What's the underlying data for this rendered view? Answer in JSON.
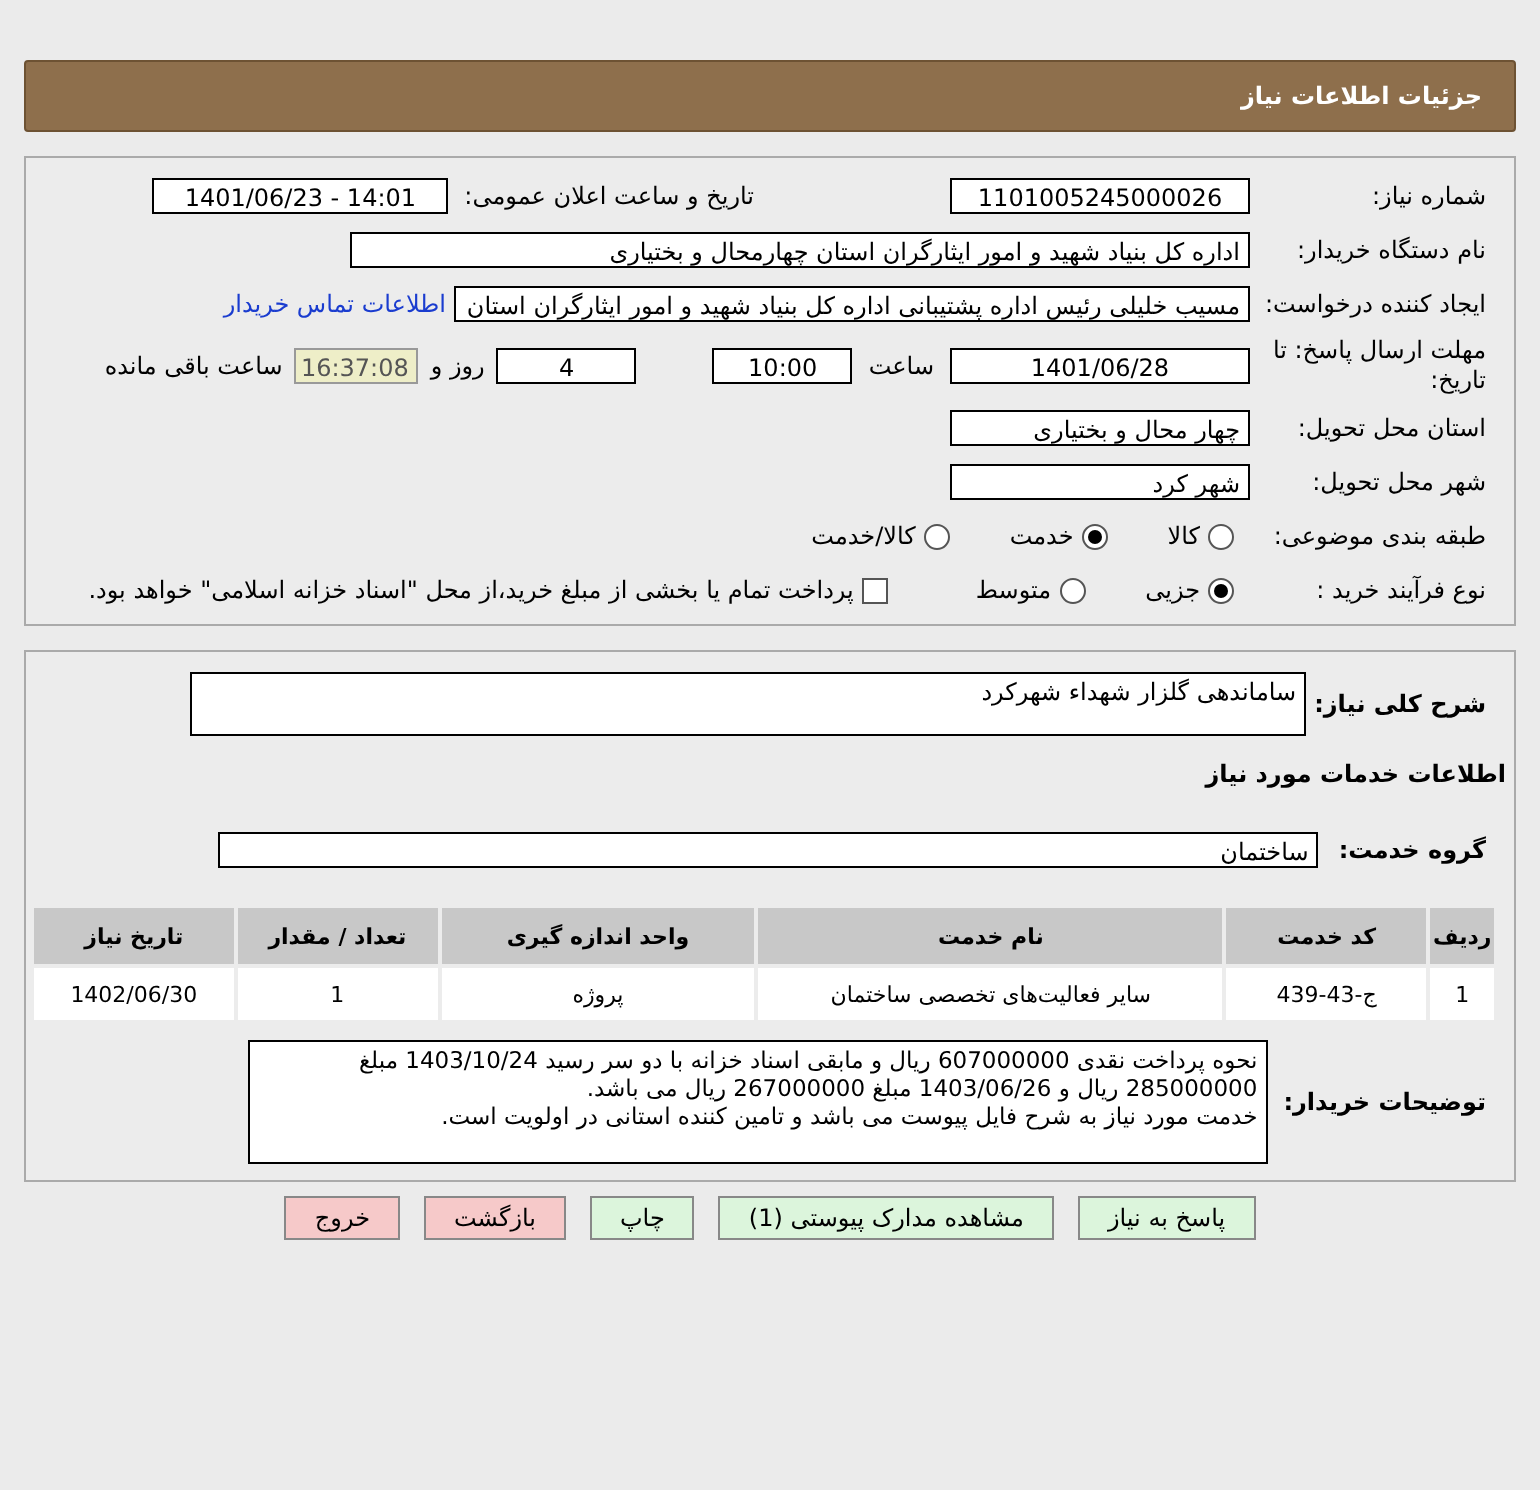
{
  "header": {
    "title": "جزئیات اطلاعات نیاز"
  },
  "need_number": {
    "label": "شماره نیاز:",
    "value": "1101005245000026"
  },
  "announce": {
    "label": "تاریخ و ساعت اعلان عمومی:",
    "value": "1401/06/23 - 14:01"
  },
  "buyer": {
    "label": "نام دستگاه خریدار:",
    "value": "اداره کل بنیاد شهید و امور ایثارگران استان چهارمحال و بختیاری"
  },
  "requester": {
    "label": "ایجاد کننده درخواست:",
    "value": "مسیب خلیلی رئیس اداره پشتیبانی اداره کل بنیاد شهید و امور ایثارگران استان",
    "link": "اطلاعات تماس خریدار"
  },
  "deadline": {
    "label": "مهلت ارسال پاسخ: تا تاریخ:",
    "date": "1401/06/28",
    "time_label": "ساعت",
    "time": "10:00",
    "days": "4",
    "days_label": "روز و",
    "remaining": "16:37:08",
    "remaining_label": "ساعت باقی مانده"
  },
  "province": {
    "label": "استان محل تحویل:",
    "value": "چهار محال و بختیاری"
  },
  "city": {
    "label": "شهر محل تحویل:",
    "value": "شهر کرد"
  },
  "category": {
    "label": "طبقه بندی موضوعی:",
    "options": [
      {
        "label": "کالا",
        "selected": false
      },
      {
        "label": "خدمت",
        "selected": true
      },
      {
        "label": "کالا/خدمت",
        "selected": false
      }
    ]
  },
  "process": {
    "label": "نوع فرآیند خرید :",
    "options": [
      {
        "label": "جزیی",
        "selected": true
      },
      {
        "label": "متوسط",
        "selected": false
      }
    ],
    "checkbox": {
      "label": "پرداخت تمام یا بخشی از مبلغ خرید،از محل \"اسناد خزانه اسلامی\" خواهد بود.",
      "checked": false
    }
  },
  "summary": {
    "label": "شرح کلی نیاز:",
    "value": "ساماندهی گلزار شهداء شهرکرد"
  },
  "services_title": "اطلاعات خدمات مورد نیاز",
  "service_group": {
    "label": "گروه خدمت:",
    "value": "ساختمان"
  },
  "table": {
    "columns": [
      "ردیف",
      "کد خدمت",
      "نام خدمت",
      "واحد اندازه گیری",
      "تعداد / مقدار",
      "تاریخ نیاز"
    ],
    "rows": [
      [
        "1",
        "ج-43-439",
        "سایر فعالیت‌های تخصصی ساختمان",
        "پروژه",
        "1",
        "1402/06/30"
      ]
    ]
  },
  "buyer_notes": {
    "label": "توضیحات خریدار:",
    "paragraphs": [
      "نحوه پرداخت نقدی 607000000 ریال و مابقی اسناد خزانه با دو سر رسید 1403/10/24 مبلغ 285000000 ریال و 1403/06/26 مبلغ 267000000 ریال می باشد.",
      "خدمت مورد نیاز به شرح فایل پیوست می باشد و تامین کننده استانی در اولویت است."
    ]
  },
  "buttons": [
    {
      "label": "پاسخ به نیاز",
      "kind": "normal"
    },
    {
      "label": "مشاهده مدارک پیوستی (1)",
      "kind": "normal"
    },
    {
      "label": "چاپ",
      "kind": "normal"
    },
    {
      "label": "بازگشت",
      "kind": "danger"
    },
    {
      "label": "خروج",
      "kind": "danger"
    }
  ]
}
